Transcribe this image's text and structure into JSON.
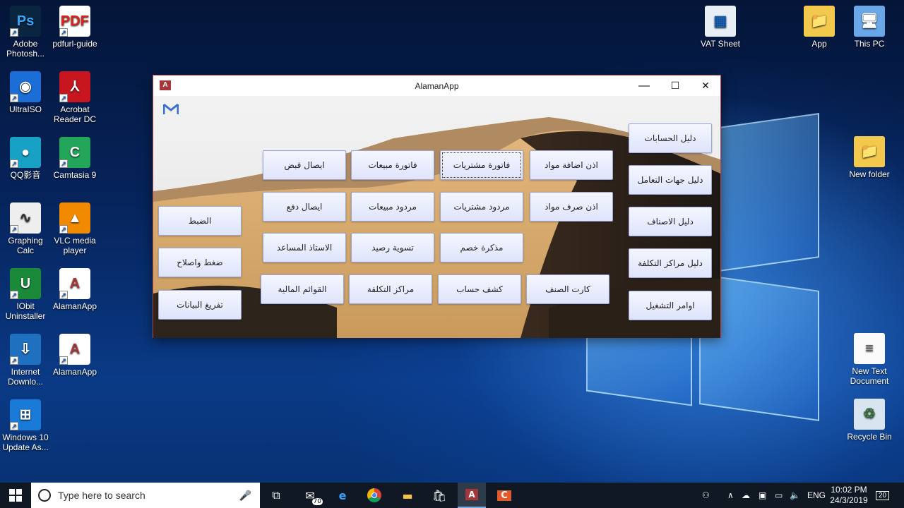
{
  "desktop": {
    "left_icons": [
      {
        "label": "Adobe Photosh...",
        "glyph": "Ps",
        "icon": "photoshop-icon"
      },
      {
        "label": "pdfurl-guide",
        "glyph": "PDF",
        "icon": "pdf-file-icon"
      },
      {
        "label": "UltraISO",
        "glyph": "◉",
        "icon": "ultraiso-icon"
      },
      {
        "label": "Acrobat Reader DC",
        "glyph": "⅄",
        "icon": "acrobat-icon"
      },
      {
        "label": "QQ影音",
        "glyph": "●",
        "icon": "qq-player-icon"
      },
      {
        "label": "Camtasia 9",
        "glyph": "C",
        "icon": "camtasia-icon"
      },
      {
        "label": "Graphing Calc",
        "glyph": "∿",
        "icon": "graphing-calc-icon"
      },
      {
        "label": "VLC media player",
        "glyph": "▲",
        "icon": "vlc-icon"
      },
      {
        "label": "IObit Uninstaller",
        "glyph": "U",
        "icon": "iobit-icon"
      },
      {
        "label": "AlamanApp",
        "glyph": "A",
        "icon": "access-db-icon"
      },
      {
        "label": "Internet Downlo...",
        "glyph": "⇩",
        "icon": "idm-icon"
      },
      {
        "label": "AlamanApp",
        "glyph": "A",
        "icon": "access-db-locked-icon"
      },
      {
        "label": "Windows 10 Update As...",
        "glyph": "⊞",
        "icon": "windows-update-icon"
      }
    ],
    "right_icons": [
      {
        "label": "VAT Sheet",
        "glyph": "▦",
        "icon": "vat-sheet-icon"
      },
      {
        "label": "App",
        "glyph": "📁",
        "icon": "folder-icon"
      },
      {
        "label": "This PC",
        "glyph": "🖥",
        "icon": "this-pc-icon"
      },
      {
        "label": "New folder",
        "glyph": "📁",
        "icon": "new-folder-icon"
      },
      {
        "label": "New Text Document",
        "glyph": "≡",
        "icon": "text-document-icon"
      },
      {
        "label": "Recycle Bin",
        "glyph": "♲",
        "icon": "recycle-bin-icon"
      }
    ]
  },
  "window": {
    "title": "AlamanApp",
    "minimize": "—",
    "maximize": "☐",
    "close": "✕",
    "right_column": [
      "دليل الحسابات",
      "دليل جهات التعامل",
      "دليل الاصناف",
      "دليل مراكز التكلفة",
      "اوامر التشغيل"
    ],
    "grid_row1": [
      "اذن اضافة مواد",
      "فاتورة مشتريات",
      "فاتورة مبيعات",
      "ايصال قبض"
    ],
    "grid_row2": [
      "اذن صرف مواد",
      "مردود مشتريات",
      "مردود مبيعات",
      "ايصال دفع"
    ],
    "grid_row3": [
      "مذكرة خصم",
      "تسوية رصيد",
      "الاستاذ المساعد"
    ],
    "grid_row4": [
      "كارت الصنف",
      "كشف حساب",
      "مراكز التكلفة",
      "القوائم المالية"
    ],
    "left_column": [
      "الضبط",
      "ضغط واصلاح",
      "تفريغ البيانات"
    ]
  },
  "taskbar": {
    "search_placeholder": "Type here to search",
    "mail_badge": "70",
    "lang": "ENG",
    "time": "10:02 PM",
    "date": "24/3/2019",
    "notif_count": "20"
  }
}
